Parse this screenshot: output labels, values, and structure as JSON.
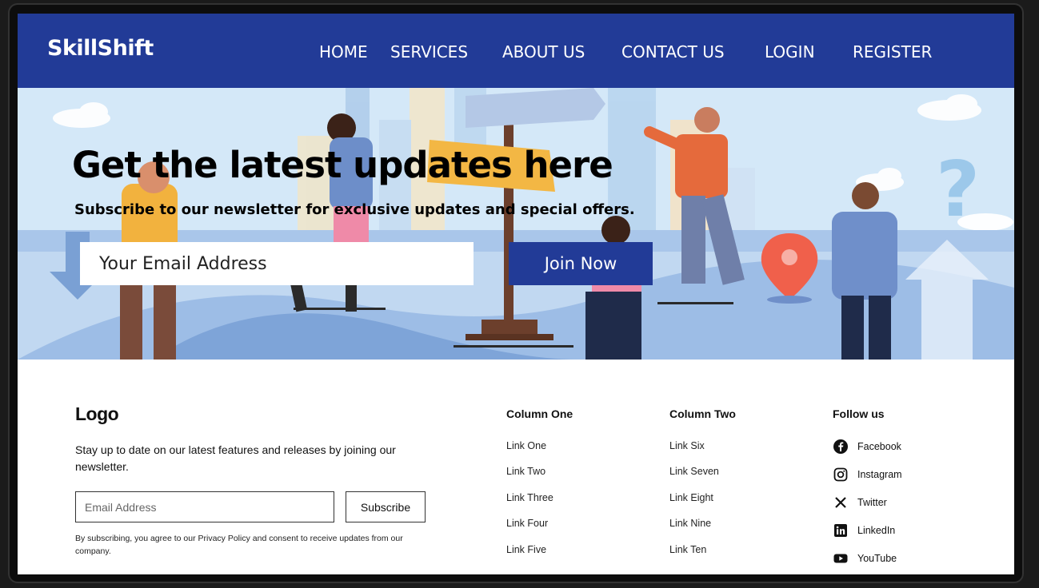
{
  "nav": {
    "brand": "SkillShift",
    "links": [
      "HOME",
      "SERVICES",
      "ABOUT US",
      "CONTACT US",
      "LOGIN",
      "REGISTER"
    ]
  },
  "hero": {
    "title": "Get the latest updates here",
    "subtitle": "Subscribe to our newsletter for exclusive updates and special offers.",
    "email_placeholder": "Your Email Address",
    "button_label": "Join Now"
  },
  "footer": {
    "logo": "Logo",
    "description": "Stay up to date on our latest features and releases by joining our newsletter.",
    "email_placeholder": "Email Address",
    "subscribe_label": "Subscribe",
    "note": "By subscribing, you agree to our Privacy Policy and consent to receive updates from our company.",
    "column_one": {
      "title": "Column One",
      "links": [
        "Link One",
        "Link Two",
        "Link Three",
        "Link Four",
        "Link Five"
      ]
    },
    "column_two": {
      "title": "Column Two",
      "links": [
        "Link Six",
        "Link Seven",
        "Link Eight",
        "Link Nine",
        "Link Ten"
      ]
    },
    "follow": {
      "title": "Follow us",
      "items": [
        {
          "label": "Facebook",
          "icon": "facebook-icon"
        },
        {
          "label": "Instagram",
          "icon": "instagram-icon"
        },
        {
          "label": "Twitter",
          "icon": "x-icon"
        },
        {
          "label": "LinkedIn",
          "icon": "linkedin-icon"
        },
        {
          "label": "YouTube",
          "icon": "youtube-icon"
        }
      ]
    }
  },
  "colors": {
    "primary": "#223b97",
    "hero_bg": "#cfe4f6"
  }
}
